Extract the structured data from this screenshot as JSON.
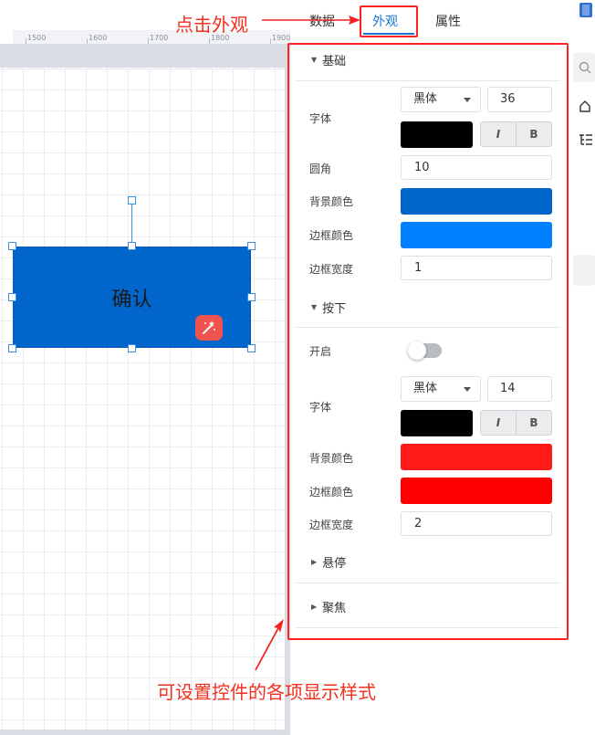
{
  "tabs": [
    {
      "label": "数据"
    },
    {
      "label": "外观"
    },
    {
      "label": "属性"
    }
  ],
  "ruler": {
    "ticks": [
      "1500",
      "1600",
      "1700",
      "1800",
      "1900"
    ]
  },
  "canvas": {
    "button_text": "确认"
  },
  "basic": {
    "title": "基础",
    "font_label": "字体",
    "font_family": "黑体",
    "font_size": "36",
    "font_color": "#000000",
    "italic_label": "I",
    "bold_label": "B",
    "radius_label": "圆角",
    "radius_value": "10",
    "bg_label": "背景颜色",
    "bg_color": "#0066cc",
    "border_label": "边框颜色",
    "border_color": "#0080ff",
    "border_width_label": "边框宽度",
    "border_width_value": "1"
  },
  "pressed": {
    "title": "按下",
    "enable_label": "开启",
    "enabled": false,
    "font_label": "字体",
    "font_family": "黑体",
    "font_size": "14",
    "font_color": "#000000",
    "italic_label": "I",
    "bold_label": "B",
    "bg_label": "背景颜色",
    "bg_color": "#ff1a1a",
    "border_label": "边框颜色",
    "border_color": "#ff0000",
    "border_width_label": "边框宽度",
    "border_width_value": "2"
  },
  "hover": {
    "title": "悬停"
  },
  "focus": {
    "title": "聚焦"
  },
  "annotations": {
    "click_appearance": "点击外观",
    "style_hint": "可设置控件的各项显示样式"
  },
  "colors": {
    "annotation": "#f22222",
    "accent": "#1976d2"
  }
}
